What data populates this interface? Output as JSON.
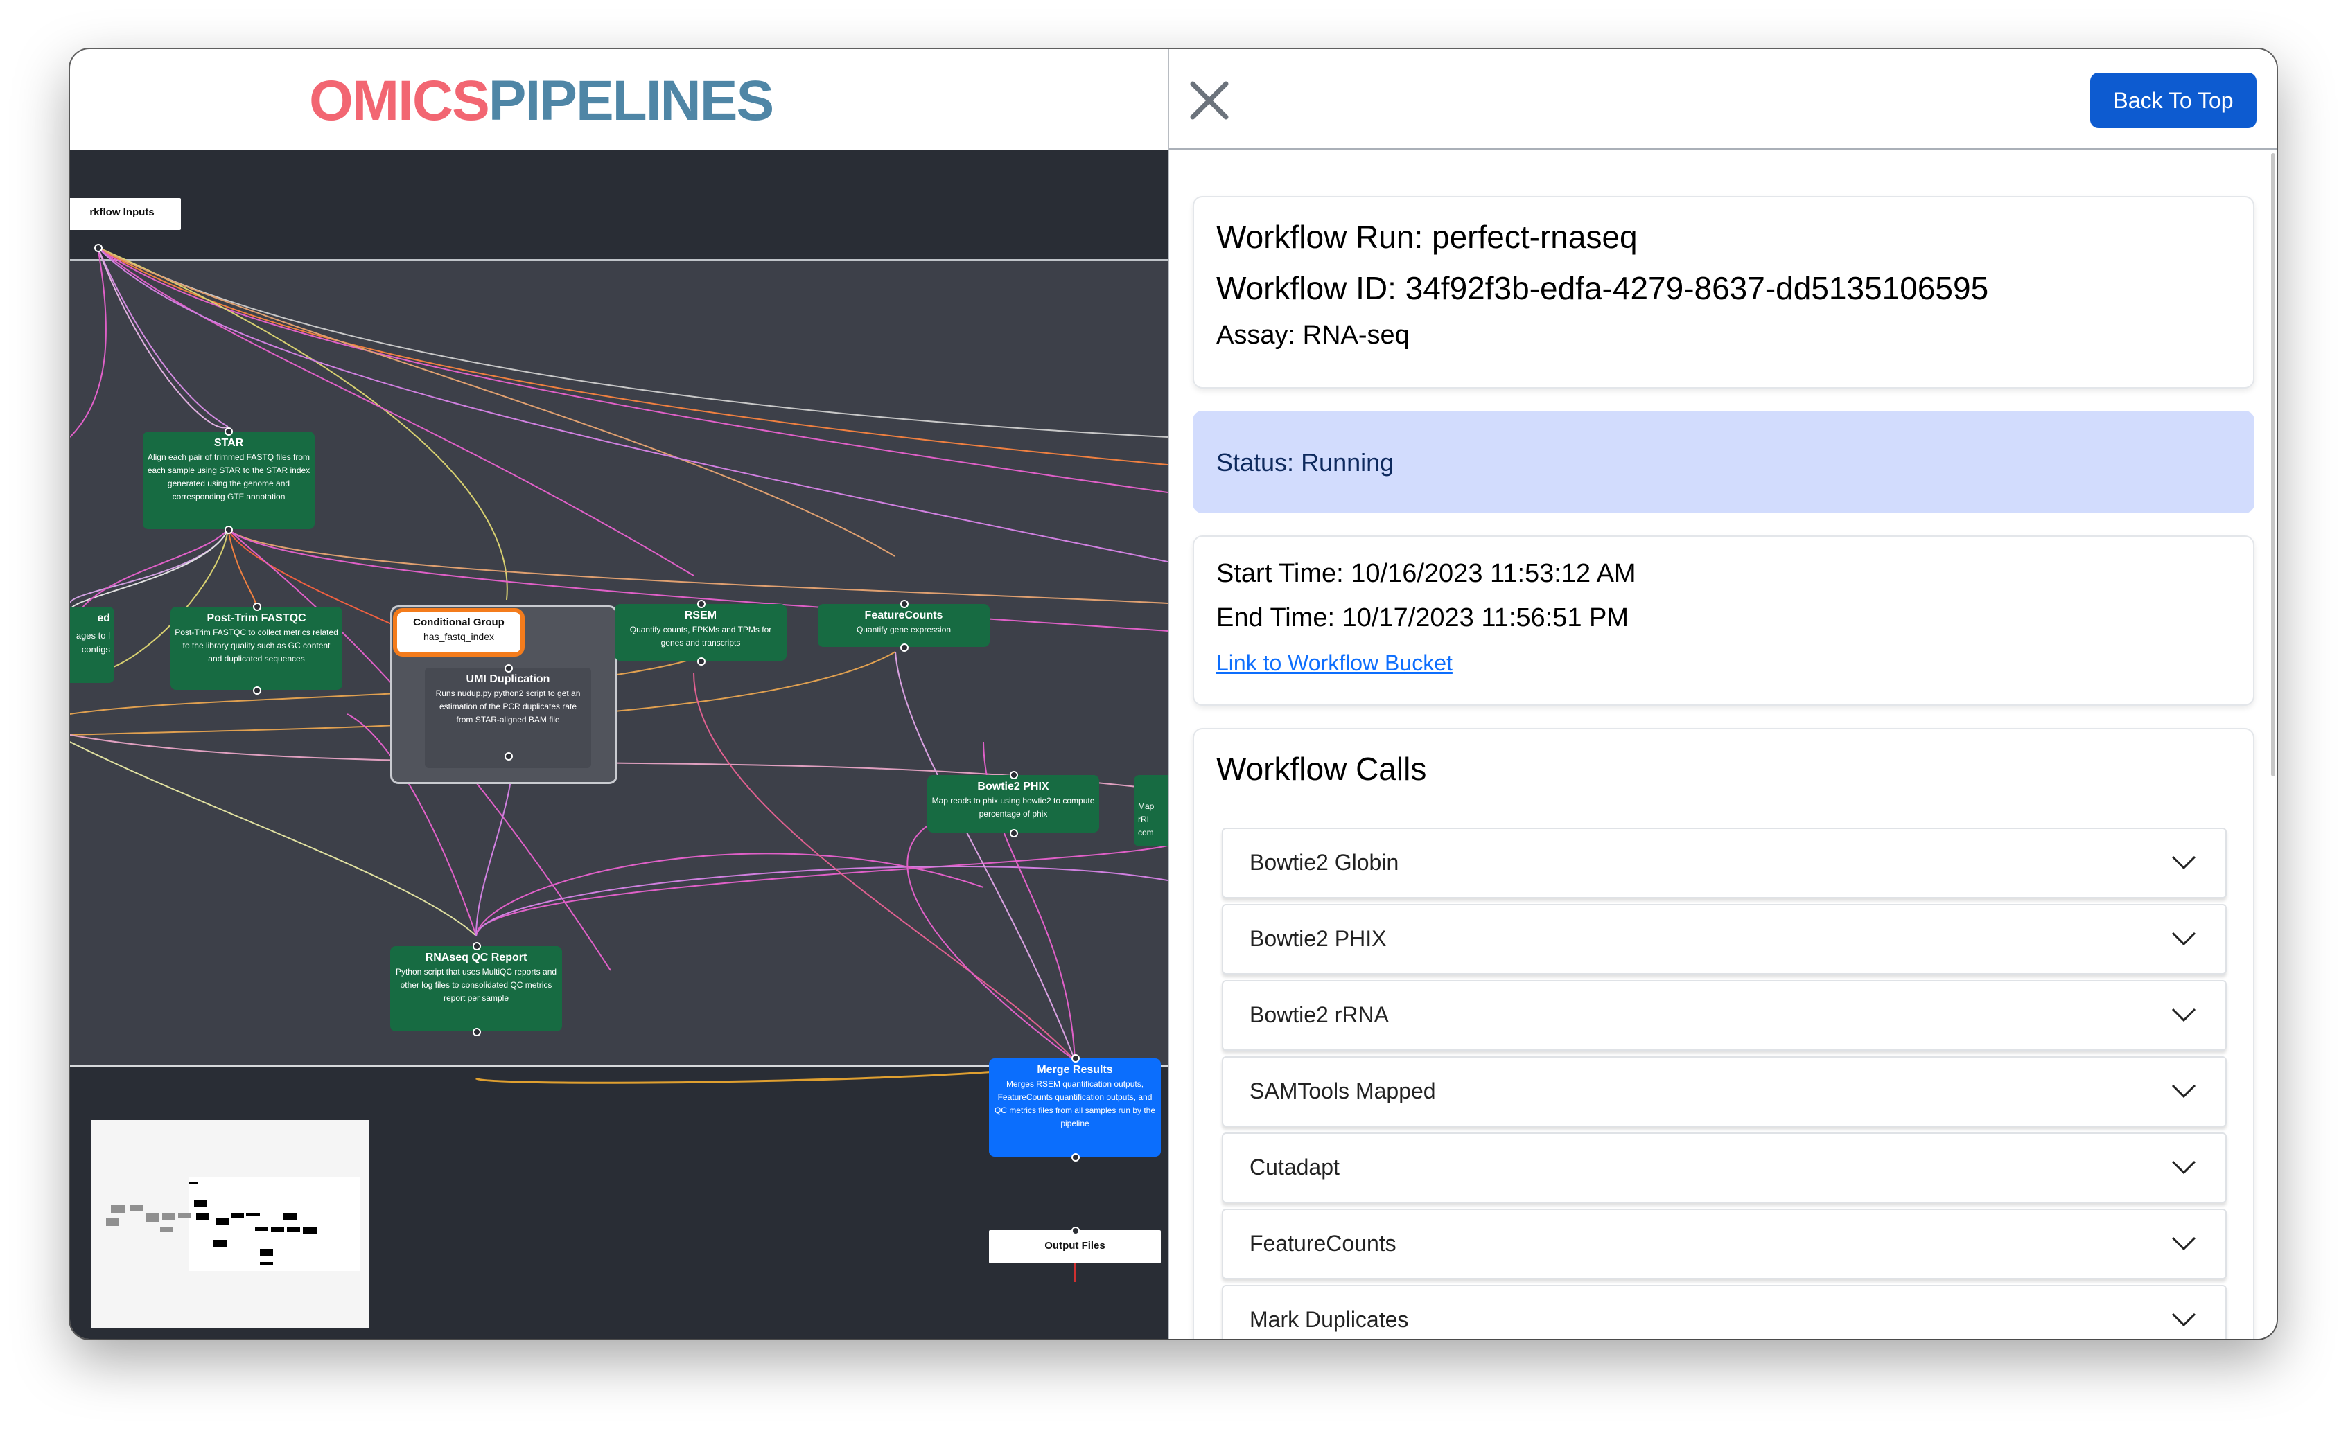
{
  "logo": {
    "part1": "OMICS",
    "part2": "PIPELINES"
  },
  "graph": {
    "nodes": {
      "workflow_inputs": {
        "title": "rkflow Inputs"
      },
      "star": {
        "title": "STAR",
        "desc": "Align each pair of trimmed FASTQ files from each sample using STAR to the STAR index generated using the genome and corresponding GTF annotation"
      },
      "partial_left": {
        "title": "ed",
        "desc": "ages to l contigs"
      },
      "post_trim_fastqc": {
        "title": "Post-Trim FASTQC",
        "desc": "Post-Trim FASTQC to collect metrics related to the library quality such as GC content and duplicated sequences"
      },
      "conditional_group": {
        "title": "Conditional Group",
        "desc": "has_fastq_index"
      },
      "umi_duplication": {
        "title": "UMI Duplication",
        "desc": "Runs nudup.py python2 script to get an estimation of the PCR duplicates rate from STAR-aligned BAM file"
      },
      "rsem": {
        "title": "RSEM",
        "desc": "Quantify counts, FPKMs and TPMs for genes and transcripts"
      },
      "featurecounts": {
        "title": "FeatureCounts",
        "desc": "Quantify gene expression"
      },
      "bowtie2_phix": {
        "title": "Bowtie2 PHIX",
        "desc": "Map reads to phix using bowtie2 to compute percentage of phix"
      },
      "partial_right": {
        "title": "",
        "desc": "Map rRI com"
      },
      "rnaseq_qc_report": {
        "title": "RNAseq QC Report",
        "desc": "Python script that uses MultiQC reports and other log files to consolidated QC metrics report per sample"
      },
      "merge_results": {
        "title": "Merge Results",
        "desc": "Merges RSEM quantification outputs, FeatureCounts quantification outputs, and QC metrics files from all samples run by the pipeline"
      },
      "output_files": {
        "title": "Output Files"
      }
    }
  },
  "panel": {
    "close_icon": "close-icon",
    "back_to_top": "Back To Top",
    "workflow_run": "Workflow Run: perfect-rnaseq",
    "workflow_id": "Workflow ID: 34f92f3b-edfa-4279-8637-dd5135106595",
    "assay": "Assay: RNA-seq",
    "status": "Status: Running",
    "start_time": "Start Time: 10/16/2023 11:53:12 AM",
    "end_time": "End Time: 10/17/2023 11:56:51 PM",
    "bucket_link": "Link to Workflow Bucket",
    "calls_title": "Workflow Calls",
    "calls": [
      {
        "label": "Bowtie2 Globin"
      },
      {
        "label": "Bowtie2 PHIX"
      },
      {
        "label": "Bowtie2 rRNA"
      },
      {
        "label": "SAMTools Mapped"
      },
      {
        "label": "Cutadapt"
      },
      {
        "label": "FeatureCounts"
      },
      {
        "label": "Mark Duplicates"
      }
    ]
  },
  "colors": {
    "logo_red": "#f26672",
    "logo_blue": "#4f86a6",
    "node_green": "#176b42",
    "node_blue": "#0b6efd",
    "conditional_orange": "#f47c1c",
    "status_bg": "#d2dcfd",
    "button_blue": "#0d5bd0"
  }
}
